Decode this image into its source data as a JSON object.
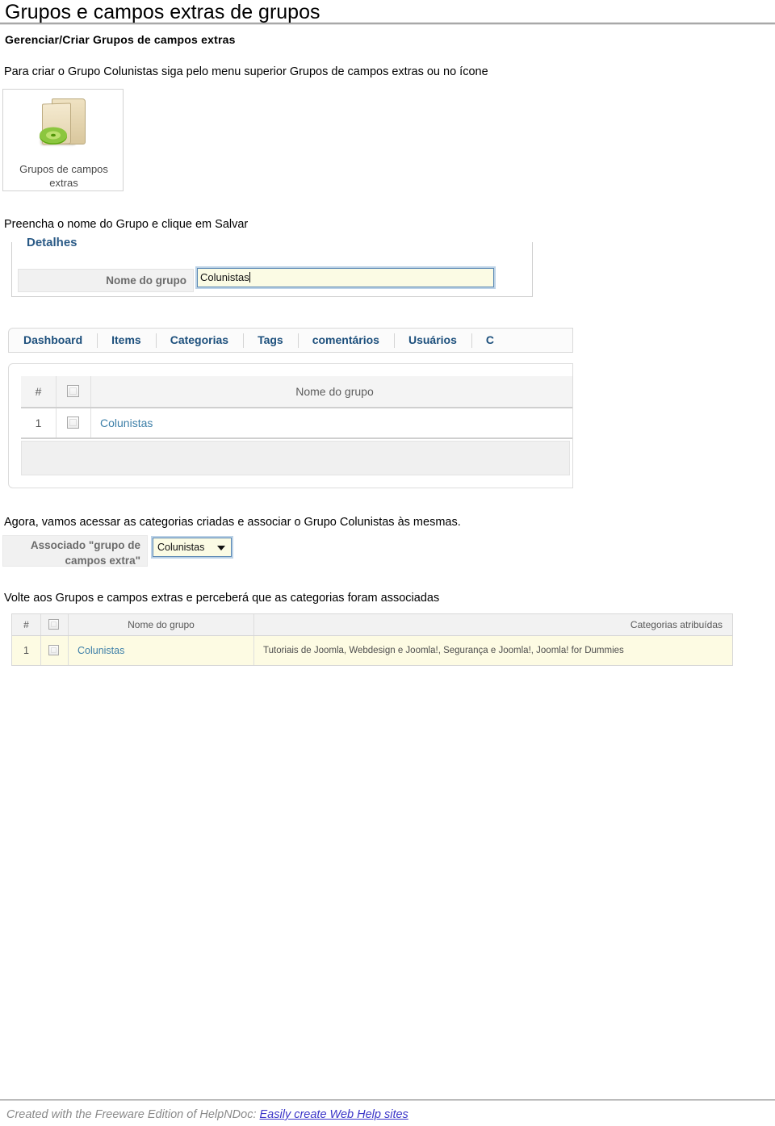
{
  "document": {
    "title": "Grupos e campos extras de grupos",
    "subheading": "Gerenciar/Criar Grupos de campos extras",
    "paragraphs": {
      "criar": "Para criar o Grupo Colunistas siga pelo menu superior Grupos de campos extras ou no ícone",
      "preencha": "Preencha o nome do Grupo e clique em Salvar",
      "agora": "Agora, vamos acessar as categorias criadas e associar o Grupo Colunistas às mesmas.",
      "volte": "Volte aos Grupos e campos extras e perceberá que as categorias foram associadas"
    }
  },
  "icon_card": {
    "icon": "folder-green-arrow-icon",
    "caption_line1": "Grupos de campos",
    "caption_line2": "extras"
  },
  "details_form": {
    "legend": "Detalhes",
    "field_label": "Nome do grupo",
    "field_value": "Colunistas",
    "field_placeholder": ""
  },
  "tabbar": {
    "tabs": [
      {
        "label": "Dashboard"
      },
      {
        "label": "Items"
      },
      {
        "label": "Categorias"
      },
      {
        "label": "Tags"
      },
      {
        "label": "comentários"
      },
      {
        "label": "Usuários"
      },
      {
        "label": "C"
      }
    ]
  },
  "groups_table": {
    "headers": {
      "index": "#",
      "checkbox": "",
      "name": "Nome do grupo"
    },
    "rows": [
      {
        "index": "1",
        "name": "Colunistas"
      }
    ]
  },
  "associacao": {
    "label_line1": "Associado \"grupo de",
    "label_line2": "campos extra\"",
    "selected": "Colunistas",
    "caret": "chevron-down-icon"
  },
  "assigned_table": {
    "headers": {
      "index": "#",
      "checkbox": "",
      "name": "Nome do grupo",
      "categories": "Categorias atribuídas"
    },
    "rows": [
      {
        "index": "1",
        "name": "Colunistas",
        "categories": "Tutoriais de Joomla, Webdesign e Joomla!, Segurança e Joomla!, Joomla! for Dummies"
      }
    ]
  },
  "footer": {
    "text": "Created with the Freeware Edition of HelpNDoc:",
    "link": "Easily create Web Help sites"
  },
  "colors": {
    "link_blue": "#3d7fa8",
    "tab_blue": "#1c4f7c",
    "legend_blue": "#2a5a86",
    "footer_link": "#3b35c8",
    "input_bg": "#fbfbe4",
    "focus_border": "#5b88b5",
    "highlight_row": "#fdfbe3"
  }
}
